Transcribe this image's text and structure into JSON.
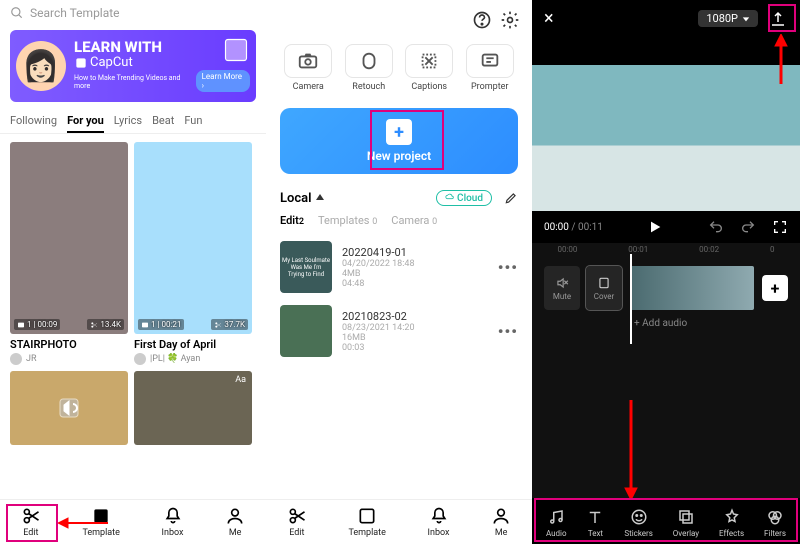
{
  "screen1": {
    "search_placeholder": "Search Template",
    "banner": {
      "title": "LEARN WITH",
      "brand": "CapCut",
      "tagline": "How to Make Trending Videos and more",
      "cta": "Learn More ›"
    },
    "tabs": [
      "Following",
      "For you",
      "Lyrics",
      "Beat",
      "Fun"
    ],
    "active_tab": "For you",
    "cards": [
      {
        "duration": "1",
        "clips": "00:09",
        "uses": "13.4K",
        "title": "STAIRPHOTO",
        "author": "JR"
      },
      {
        "duration": "1",
        "clips": "00:21",
        "uses": "37.7K",
        "title": "First Day of April",
        "author": "|PL| 🍀 Ayan"
      }
    ],
    "nav": [
      {
        "label": "Edit",
        "icon": "scissors"
      },
      {
        "label": "Template",
        "icon": "template"
      },
      {
        "label": "Inbox",
        "icon": "bell"
      },
      {
        "label": "Me",
        "icon": "person"
      }
    ]
  },
  "screen2": {
    "quick": [
      {
        "label": "Camera",
        "icon": "camera"
      },
      {
        "label": "Retouch",
        "icon": "retouch"
      },
      {
        "label": "Captions",
        "icon": "captions"
      },
      {
        "label": "Prompter",
        "icon": "prompter"
      }
    ],
    "new_project": "New project",
    "local_label": "Local",
    "cloud_label": "Cloud",
    "subtabs": {
      "edit": "Edit",
      "edit_count": "2",
      "templates": "Templates",
      "templates_count": "0",
      "camera": "Camera",
      "camera_count": "0"
    },
    "projects": [
      {
        "name": "20220419-01",
        "date": "04/20/2022 18:48",
        "size": "4MB",
        "len": "04:48"
      },
      {
        "name": "20210823-02",
        "date": "08/23/2021 14:20",
        "size": "16MB",
        "len": "00:03"
      }
    ],
    "nav": [
      {
        "label": "Edit",
        "icon": "scissors"
      },
      {
        "label": "Template",
        "icon": "template"
      },
      {
        "label": "Inbox",
        "icon": "bell"
      },
      {
        "label": "Me",
        "icon": "person"
      }
    ]
  },
  "screen3": {
    "resolution": "1080P",
    "time_current": "00:00",
    "time_total": "00:11",
    "ruler": [
      "00:00",
      "00:01",
      "00:02",
      "0"
    ],
    "side_buttons": [
      {
        "label": "Mute",
        "icon": "mute"
      },
      {
        "label": "Cover",
        "icon": "cover"
      }
    ],
    "add_audio": "+  Add audio",
    "tools": [
      {
        "label": "Audio",
        "icon": "audio"
      },
      {
        "label": "Text",
        "icon": "text"
      },
      {
        "label": "Stickers",
        "icon": "stickers"
      },
      {
        "label": "Overlay",
        "icon": "overlay"
      },
      {
        "label": "Effects",
        "icon": "effects"
      },
      {
        "label": "Filters",
        "icon": "filters"
      }
    ]
  }
}
